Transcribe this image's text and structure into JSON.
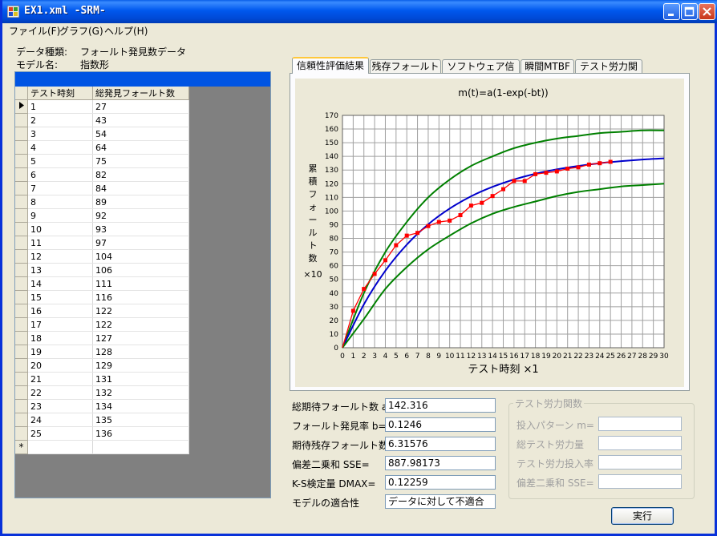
{
  "window": {
    "title": "EX1.xml -SRM-"
  },
  "menu": [
    "ファイル(F)",
    "グラフ(G)",
    "ヘルプ(H)"
  ],
  "info": {
    "data_type_label": "データ種類:",
    "data_type_value": "フォールト発見数データ",
    "model_label": "モデル名:",
    "model_value": "指数形"
  },
  "grid": {
    "headers": [
      "テスト時刻",
      "総発見フォールト数"
    ],
    "rows": [
      [
        1,
        27
      ],
      [
        2,
        43
      ],
      [
        3,
        54
      ],
      [
        4,
        64
      ],
      [
        5,
        75
      ],
      [
        6,
        82
      ],
      [
        7,
        84
      ],
      [
        8,
        89
      ],
      [
        9,
        92
      ],
      [
        10,
        93
      ],
      [
        11,
        97
      ],
      [
        12,
        104
      ],
      [
        13,
        106
      ],
      [
        14,
        111
      ],
      [
        15,
        116
      ],
      [
        16,
        122
      ],
      [
        17,
        122
      ],
      [
        18,
        127
      ],
      [
        19,
        128
      ],
      [
        20,
        129
      ],
      [
        21,
        131
      ],
      [
        22,
        132
      ],
      [
        23,
        134
      ],
      [
        24,
        135
      ],
      [
        25,
        136
      ]
    ],
    "new_row_marker": "*"
  },
  "tabs": [
    "信頼性評価結果",
    "残存フォールト数",
    "ソフトウェア信頼度",
    "瞬間MTBF",
    "テスト労力関数"
  ],
  "results": [
    {
      "label": "総期待フォールト数 a=",
      "value": "142.316"
    },
    {
      "label": "フォールト発見率 b=",
      "value": "0.1246"
    },
    {
      "label": "期待残存フォールト数",
      "value": "6.31576"
    },
    {
      "label": "偏差二乗和 SSE=",
      "value": "887.98173"
    },
    {
      "label": "K-S検定量 DMAX=",
      "value": "0.12259"
    },
    {
      "label": "モデルの適合性",
      "value": "データに対して不適合"
    }
  ],
  "effort": {
    "title": "テスト労力関数",
    "labels": [
      "投入パターン m=",
      "総テスト労力量",
      "テスト労力投入率",
      "偏差二乗和 SSE="
    ]
  },
  "run_button": "実行",
  "chart_data": {
    "type": "line",
    "title": "m(t)=a(1-exp(-bt))",
    "xlabel": "テスト時刻 ×1",
    "ylabel": [
      "累",
      "積",
      "フ",
      "ォ",
      "ー",
      "ル",
      "ト",
      "数",
      "×10"
    ],
    "xlim": [
      0,
      30
    ],
    "ylim": [
      0,
      170
    ],
    "xticks": [
      0,
      1,
      2,
      3,
      4,
      5,
      6,
      7,
      8,
      9,
      10,
      11,
      12,
      13,
      14,
      15,
      16,
      17,
      18,
      19,
      20,
      21,
      22,
      23,
      24,
      25,
      26,
      27,
      28,
      29,
      30
    ],
    "yticks": [
      0,
      10,
      20,
      30,
      40,
      50,
      60,
      70,
      80,
      90,
      100,
      110,
      120,
      130,
      140,
      150,
      160,
      170
    ],
    "grid": true,
    "observed": {
      "x": [
        0,
        1,
        2,
        3,
        4,
        5,
        6,
        7,
        8,
        9,
        10,
        11,
        12,
        13,
        14,
        15,
        16,
        17,
        18,
        19,
        20,
        21,
        22,
        23,
        24,
        25
      ],
      "y": [
        0,
        27,
        43,
        54,
        64,
        75,
        82,
        84,
        89,
        92,
        93,
        97,
        104,
        106,
        111,
        116,
        122,
        122,
        127,
        128,
        129,
        131,
        132,
        134,
        135,
        136
      ],
      "color": "#FF0000"
    },
    "curves": [
      {
        "role": "upper",
        "color": "#008000",
        "x": [
          0,
          2,
          4,
          6,
          8,
          10,
          12,
          14,
          16,
          18,
          20,
          22,
          24,
          26,
          28,
          30
        ],
        "y": [
          0,
          40,
          70,
          92,
          110,
          123,
          133,
          140,
          146,
          150,
          153,
          155,
          157,
          158,
          159,
          159
        ]
      },
      {
        "role": "mean",
        "color": "#0000CC",
        "x": [
          0,
          2,
          4,
          6,
          8,
          10,
          12,
          14,
          16,
          18,
          20,
          22,
          24,
          26,
          28,
          30
        ],
        "y": [
          0,
          31.7,
          56.3,
          75.4,
          90.3,
          101.8,
          110.8,
          117.7,
          123.1,
          127.3,
          130.5,
          133.0,
          135.0,
          136.5,
          137.7,
          138.6
        ]
      },
      {
        "role": "lower",
        "color": "#008000",
        "x": [
          0,
          2,
          4,
          6,
          8,
          10,
          12,
          14,
          16,
          18,
          20,
          22,
          24,
          26,
          28,
          30
        ],
        "y": [
          0,
          21,
          43,
          59,
          72,
          82,
          91,
          98,
          103,
          107,
          111,
          114,
          116,
          118,
          119,
          120
        ]
      }
    ]
  }
}
